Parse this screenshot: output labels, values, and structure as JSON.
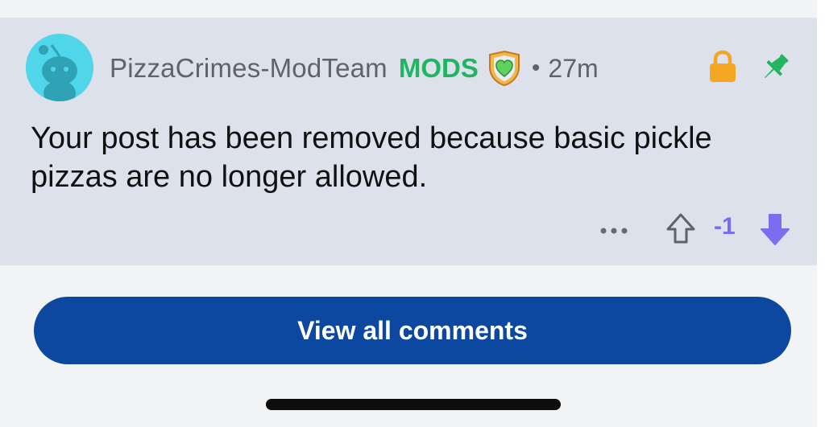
{
  "comment": {
    "username": "PizzaCrimes-ModTeam",
    "role_label": "MODS",
    "separator": "•",
    "timestamp": "27m",
    "body": "Your post has been removed because basic pickle pizzas are no longer allowed.",
    "vote_count": "-1",
    "icons": {
      "avatar": "snoo-avatar",
      "badge": "mod-shield-heart-badge",
      "lock": "lock-icon",
      "pin": "pin-icon",
      "more": "more-options-icon",
      "upvote": "upvote-arrow-icon",
      "downvote": "downvote-arrow-icon"
    }
  },
  "footer": {
    "view_all_label": "View all comments"
  },
  "colors": {
    "card_background": "#dce1ec",
    "mods_green": "#21b562",
    "lock_orange": "#f5a623",
    "pin_green": "#21b562",
    "vote_purple": "#7c6cf0",
    "button_blue": "#0c48a0"
  }
}
